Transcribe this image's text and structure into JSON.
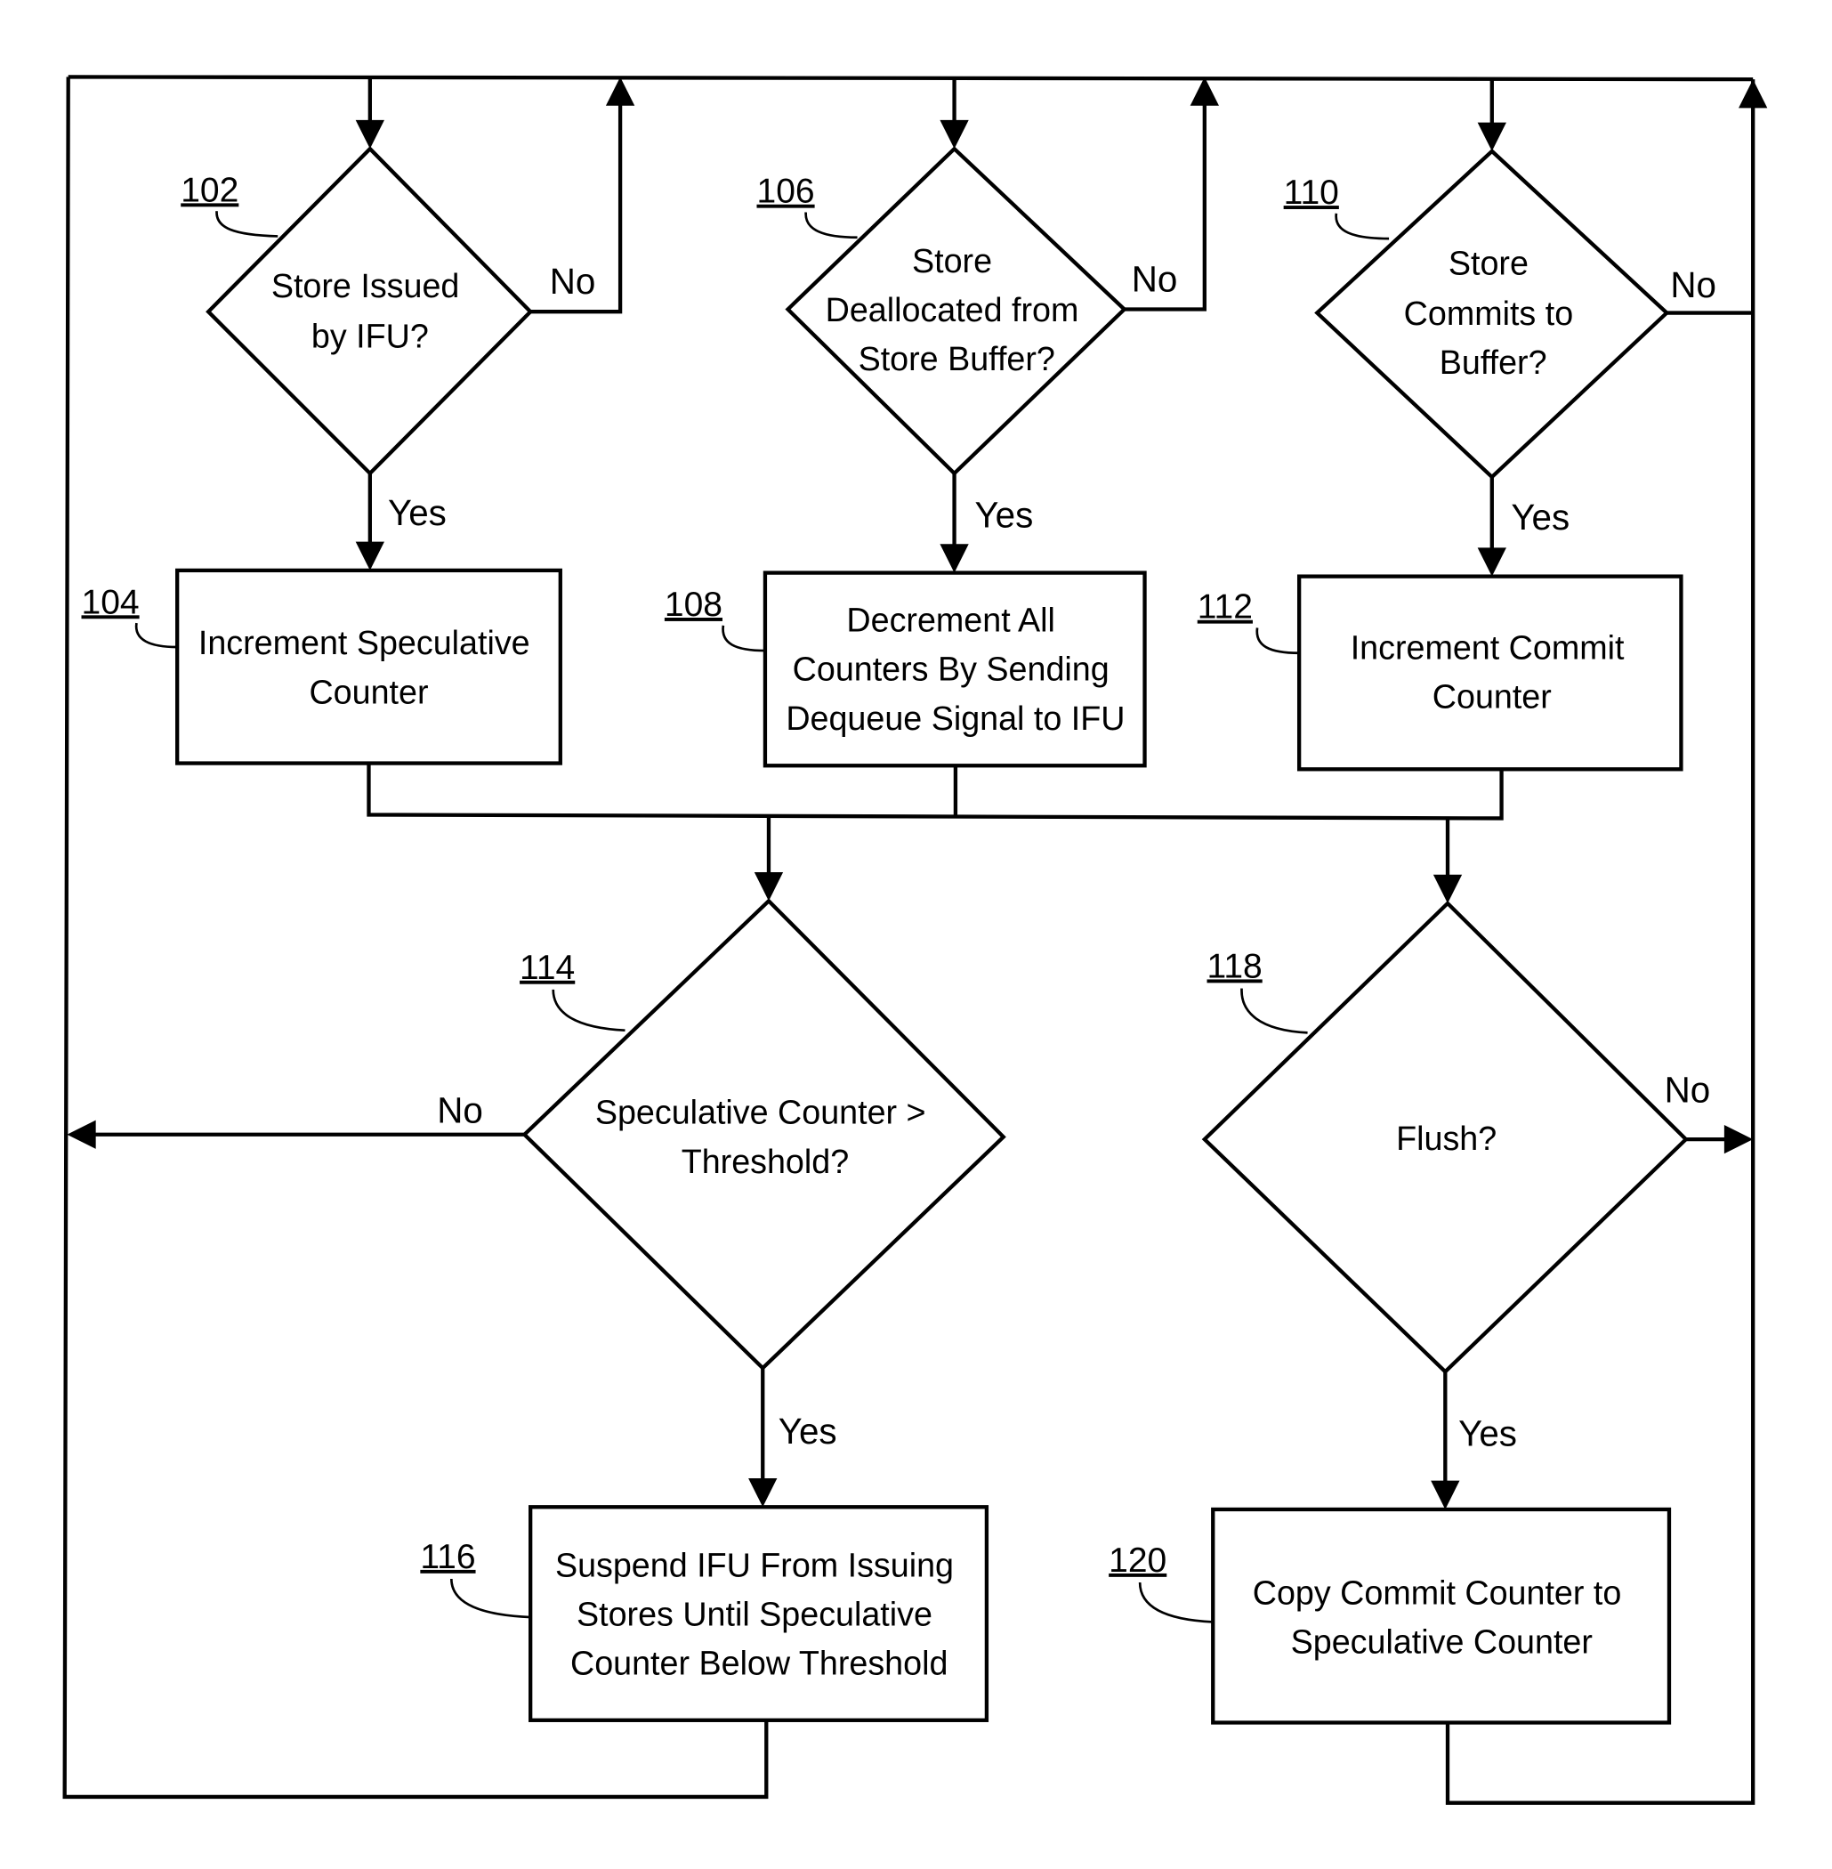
{
  "nodes": {
    "n102": {
      "ref": "102",
      "type": "decision",
      "lines": [
        "Store Issued",
        "by IFU?"
      ]
    },
    "n104": {
      "ref": "104",
      "type": "process",
      "lines": [
        "Increment Speculative",
        "Counter"
      ]
    },
    "n106": {
      "ref": "106",
      "type": "decision",
      "lines": [
        "Store",
        "Deallocated from",
        "Store Buffer?"
      ]
    },
    "n108": {
      "ref": "108",
      "type": "process",
      "lines": [
        "Decrement All",
        "Counters By Sending",
        "Dequeue Signal to IFU"
      ]
    },
    "n110": {
      "ref": "110",
      "type": "decision",
      "lines": [
        "Store",
        "Commits to",
        "Buffer?"
      ]
    },
    "n112": {
      "ref": "112",
      "type": "process",
      "lines": [
        "Increment Commit",
        "Counter"
      ]
    },
    "n114": {
      "ref": "114",
      "type": "decision",
      "lines": [
        "Speculative Counter >",
        "Threshold?"
      ]
    },
    "n116": {
      "ref": "116",
      "type": "process",
      "lines": [
        "Suspend IFU From Issuing",
        "Stores Until Speculative",
        "Counter Below Threshold"
      ]
    },
    "n118": {
      "ref": "118",
      "type": "decision",
      "lines": [
        "Flush?"
      ]
    },
    "n120": {
      "ref": "120",
      "type": "process",
      "lines": [
        "Copy Commit Counter to",
        "Speculative Counter"
      ]
    }
  },
  "edge_labels": {
    "no": "No",
    "yes": "Yes"
  },
  "edges": [
    {
      "from": "102",
      "to": "104",
      "label": "Yes"
    },
    {
      "from": "102",
      "to": "loop",
      "label": "No"
    },
    {
      "from": "106",
      "to": "108",
      "label": "Yes"
    },
    {
      "from": "106",
      "to": "loop",
      "label": "No"
    },
    {
      "from": "110",
      "to": "112",
      "label": "Yes"
    },
    {
      "from": "110",
      "to": "loop",
      "label": "No"
    },
    {
      "from": "104",
      "to": "114"
    },
    {
      "from": "108",
      "to": "114"
    },
    {
      "from": "112",
      "to": "118"
    },
    {
      "from": "114",
      "to": "116",
      "label": "Yes"
    },
    {
      "from": "114",
      "to": "loop",
      "label": "No"
    },
    {
      "from": "118",
      "to": "120",
      "label": "Yes"
    },
    {
      "from": "118",
      "to": "loop",
      "label": "No"
    },
    {
      "from": "116",
      "to": "loop"
    },
    {
      "from": "120",
      "to": "loop"
    }
  ]
}
